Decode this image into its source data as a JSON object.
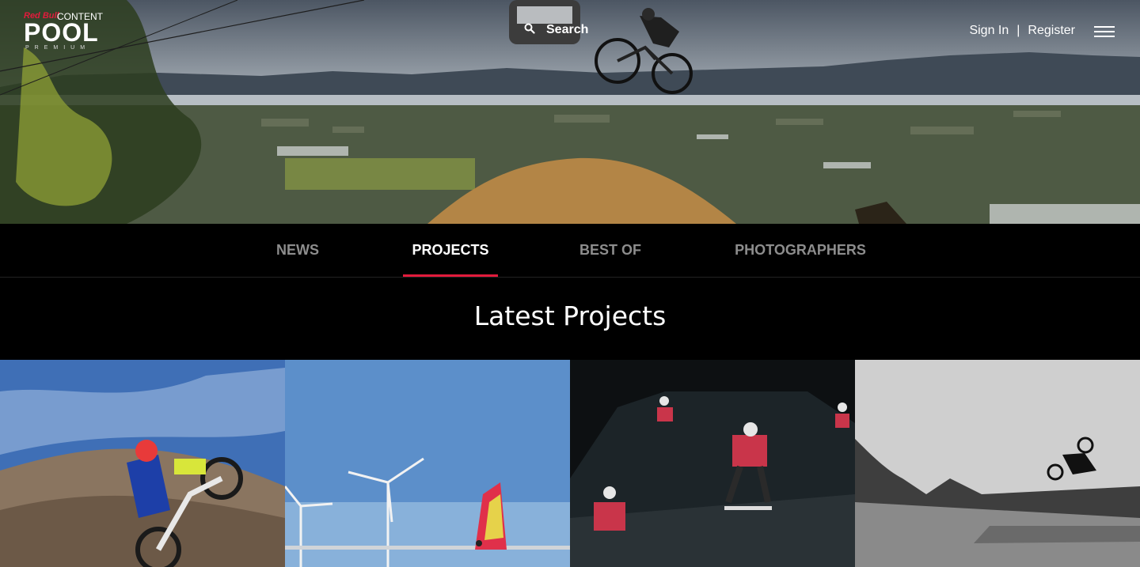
{
  "header": {
    "logo": {
      "brand": "Red Bull",
      "content": "CONTENT",
      "pool": "POOL",
      "premium": "PREMIUM"
    },
    "search": {
      "label": "Search"
    },
    "auth": {
      "sign_in": "Sign In",
      "separator": "|",
      "register": "Register"
    }
  },
  "nav": {
    "tabs": [
      {
        "label": "NEWS",
        "active": false
      },
      {
        "label": "PROJECTS",
        "active": true
      },
      {
        "label": "BEST OF",
        "active": false
      },
      {
        "label": "PHOTOGRAPHERS",
        "active": false
      }
    ]
  },
  "section": {
    "title": "Latest Projects"
  },
  "colors": {
    "accent": "#e21b3c",
    "background": "#000000",
    "tab_inactive": "#8d8d8d"
  }
}
